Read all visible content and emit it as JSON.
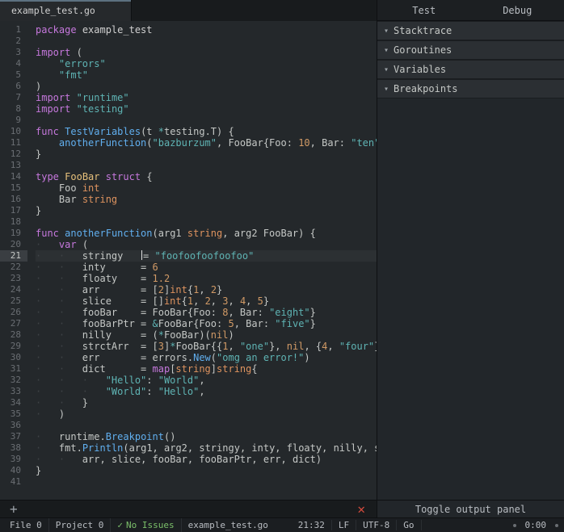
{
  "tab": {
    "filename": "example_test.go"
  },
  "sidebar": {
    "tabs": [
      "Test",
      "Debug"
    ],
    "sections": [
      "Stacktrace",
      "Goroutines",
      "Variables",
      "Breakpoints"
    ],
    "footer": "Toggle output panel"
  },
  "status": {
    "file_label": "File",
    "file_count": "0",
    "project_label": "Project",
    "project_count": "0",
    "issues": "No Issues",
    "filename": "example_test.go",
    "cursor": "21:32",
    "eol": "LF",
    "encoding": "UTF-8",
    "lang": "Go",
    "clock": "0:00"
  },
  "editor": {
    "current_line": 21,
    "cursor_col": 32
  },
  "code": {
    "lines": [
      {
        "n": 1,
        "tokens": [
          [
            "kw",
            "package"
          ],
          [
            "op",
            " "
          ],
          [
            "pkg",
            "example_test"
          ]
        ]
      },
      {
        "n": 2,
        "tokens": []
      },
      {
        "n": 3,
        "tokens": [
          [
            "kw",
            "import"
          ],
          [
            "op",
            " "
          ],
          [
            "punc",
            "("
          ]
        ]
      },
      {
        "n": 4,
        "tokens": [
          [
            "ind",
            "    "
          ],
          [
            "str",
            "\"errors\""
          ]
        ]
      },
      {
        "n": 5,
        "tokens": [
          [
            "ind",
            "    "
          ],
          [
            "str",
            "\"fmt\""
          ]
        ]
      },
      {
        "n": 6,
        "tokens": [
          [
            "punc",
            ")"
          ]
        ]
      },
      {
        "n": 7,
        "tokens": [
          [
            "kw",
            "import"
          ],
          [
            "op",
            " "
          ],
          [
            "str",
            "\"runtime\""
          ]
        ]
      },
      {
        "n": 8,
        "tokens": [
          [
            "kw",
            "import"
          ],
          [
            "op",
            " "
          ],
          [
            "str",
            "\"testing\""
          ]
        ]
      },
      {
        "n": 9,
        "tokens": []
      },
      {
        "n": 10,
        "tokens": [
          [
            "kw",
            "func"
          ],
          [
            "op",
            " "
          ],
          [
            "fn",
            "TestVariables"
          ],
          [
            "punc",
            "("
          ],
          [
            "op",
            "t "
          ],
          [
            "star",
            "*"
          ],
          [
            "op",
            "testing"
          ],
          [
            "punc",
            "."
          ],
          [
            "op",
            "T"
          ],
          [
            "punc",
            ") {"
          ]
        ]
      },
      {
        "n": 11,
        "tokens": [
          [
            "ind",
            "    "
          ],
          [
            "fn",
            "anotherFunction"
          ],
          [
            "punc",
            "("
          ],
          [
            "str",
            "\"bazburzum\""
          ],
          [
            "punc",
            ", "
          ],
          [
            "op",
            "FooBar"
          ],
          [
            "punc",
            "{"
          ],
          [
            "op",
            "Foo"
          ],
          [
            "punc",
            ": "
          ],
          [
            "num",
            "10"
          ],
          [
            "punc",
            ", "
          ],
          [
            "op",
            "Bar"
          ],
          [
            "punc",
            ": "
          ],
          [
            "str",
            "\"ten\""
          ],
          [
            "punc",
            "})"
          ]
        ]
      },
      {
        "n": 12,
        "tokens": [
          [
            "punc",
            "}"
          ]
        ]
      },
      {
        "n": 13,
        "tokens": []
      },
      {
        "n": 14,
        "tokens": [
          [
            "kw",
            "type"
          ],
          [
            "op",
            " "
          ],
          [
            "ident",
            "FooBar"
          ],
          [
            "op",
            " "
          ],
          [
            "kw",
            "struct"
          ],
          [
            "op",
            " "
          ],
          [
            "punc",
            "{"
          ]
        ]
      },
      {
        "n": 15,
        "tokens": [
          [
            "ind",
            "    "
          ],
          [
            "op",
            "Foo "
          ],
          [
            "typ",
            "int"
          ]
        ]
      },
      {
        "n": 16,
        "tokens": [
          [
            "ind",
            "    "
          ],
          [
            "op",
            "Bar "
          ],
          [
            "typ",
            "string"
          ]
        ]
      },
      {
        "n": 17,
        "tokens": [
          [
            "punc",
            "}"
          ]
        ]
      },
      {
        "n": 18,
        "tokens": []
      },
      {
        "n": 19,
        "tokens": [
          [
            "kw",
            "func"
          ],
          [
            "op",
            " "
          ],
          [
            "fn",
            "anotherFunction"
          ],
          [
            "punc",
            "("
          ],
          [
            "op",
            "arg1 "
          ],
          [
            "typ",
            "string"
          ],
          [
            "punc",
            ", "
          ],
          [
            "op",
            "arg2 FooBar"
          ],
          [
            "punc",
            ") {"
          ]
        ]
      },
      {
        "n": 20,
        "tokens": [
          [
            "ind",
            "·   "
          ],
          [
            "kw",
            "var"
          ],
          [
            "op",
            " "
          ],
          [
            "punc",
            "("
          ]
        ]
      },
      {
        "n": 21,
        "current": true,
        "tokens": [
          [
            "ind",
            "·   ·   "
          ],
          [
            "op",
            "stringy   "
          ],
          [
            "cursor",
            ""
          ],
          [
            "punc",
            "= "
          ],
          [
            "str",
            "\"foofoofoofoofoo\""
          ]
        ]
      },
      {
        "n": 22,
        "tokens": [
          [
            "ind",
            "·   ·   "
          ],
          [
            "op",
            "inty      "
          ],
          [
            "punc",
            "= "
          ],
          [
            "num",
            "6"
          ]
        ]
      },
      {
        "n": 23,
        "tokens": [
          [
            "ind",
            "·   ·   "
          ],
          [
            "op",
            "floaty    "
          ],
          [
            "punc",
            "= "
          ],
          [
            "num",
            "1.2"
          ]
        ]
      },
      {
        "n": 24,
        "tokens": [
          [
            "ind",
            "·   ·   "
          ],
          [
            "op",
            "arr       "
          ],
          [
            "punc",
            "= ["
          ],
          [
            "num",
            "2"
          ],
          [
            "punc",
            "]"
          ],
          [
            "typ",
            "int"
          ],
          [
            "punc",
            "{"
          ],
          [
            "num",
            "1"
          ],
          [
            "punc",
            ", "
          ],
          [
            "num",
            "2"
          ],
          [
            "punc",
            "}"
          ]
        ]
      },
      {
        "n": 25,
        "tokens": [
          [
            "ind",
            "·   ·   "
          ],
          [
            "op",
            "slice     "
          ],
          [
            "punc",
            "= []"
          ],
          [
            "typ",
            "int"
          ],
          [
            "punc",
            "{"
          ],
          [
            "num",
            "1"
          ],
          [
            "punc",
            ", "
          ],
          [
            "num",
            "2"
          ],
          [
            "punc",
            ", "
          ],
          [
            "num",
            "3"
          ],
          [
            "punc",
            ", "
          ],
          [
            "num",
            "4"
          ],
          [
            "punc",
            ", "
          ],
          [
            "num",
            "5"
          ],
          [
            "punc",
            "}"
          ]
        ]
      },
      {
        "n": 26,
        "tokens": [
          [
            "ind",
            "·   ·   "
          ],
          [
            "op",
            "fooBar    "
          ],
          [
            "punc",
            "= "
          ],
          [
            "op",
            "FooBar"
          ],
          [
            "punc",
            "{"
          ],
          [
            "op",
            "Foo"
          ],
          [
            "punc",
            ": "
          ],
          [
            "num",
            "8"
          ],
          [
            "punc",
            ", "
          ],
          [
            "op",
            "Bar"
          ],
          [
            "punc",
            ": "
          ],
          [
            "str",
            "\"eight\""
          ],
          [
            "punc",
            "}"
          ]
        ]
      },
      {
        "n": 27,
        "tokens": [
          [
            "ind",
            "·   ·   "
          ],
          [
            "op",
            "fooBarPtr "
          ],
          [
            "punc",
            "= "
          ],
          [
            "star",
            "&"
          ],
          [
            "op",
            "FooBar"
          ],
          [
            "punc",
            "{"
          ],
          [
            "op",
            "Foo"
          ],
          [
            "punc",
            ": "
          ],
          [
            "num",
            "5"
          ],
          [
            "punc",
            ", "
          ],
          [
            "op",
            "Bar"
          ],
          [
            "punc",
            ": "
          ],
          [
            "str",
            "\"five\""
          ],
          [
            "punc",
            "}"
          ]
        ]
      },
      {
        "n": 28,
        "tokens": [
          [
            "ind",
            "·   ·   "
          ],
          [
            "op",
            "nilly     "
          ],
          [
            "punc",
            "= ("
          ],
          [
            "star",
            "*"
          ],
          [
            "op",
            "FooBar"
          ],
          [
            "punc",
            ")("
          ],
          [
            "nil",
            "nil"
          ],
          [
            "punc",
            ")"
          ]
        ]
      },
      {
        "n": 29,
        "tokens": [
          [
            "ind",
            "·   ·   "
          ],
          [
            "op",
            "strctArr  "
          ],
          [
            "punc",
            "= ["
          ],
          [
            "num",
            "3"
          ],
          [
            "punc",
            "]"
          ],
          [
            "star",
            "*"
          ],
          [
            "op",
            "FooBar"
          ],
          [
            "punc",
            "{{"
          ],
          [
            "num",
            "1"
          ],
          [
            "punc",
            ", "
          ],
          [
            "str",
            "\"one\""
          ],
          [
            "punc",
            "}, "
          ],
          [
            "nil",
            "nil"
          ],
          [
            "punc",
            ", {"
          ],
          [
            "num",
            "4"
          ],
          [
            "punc",
            ", "
          ],
          [
            "str",
            "\"four\""
          ],
          [
            "punc",
            "}}"
          ]
        ]
      },
      {
        "n": 30,
        "tokens": [
          [
            "ind",
            "·   ·   "
          ],
          [
            "op",
            "err       "
          ],
          [
            "punc",
            "= "
          ],
          [
            "op",
            "errors"
          ],
          [
            "punc",
            "."
          ],
          [
            "fn",
            "New"
          ],
          [
            "punc",
            "("
          ],
          [
            "str",
            "\"omg an error!\""
          ],
          [
            "punc",
            ")"
          ]
        ]
      },
      {
        "n": 31,
        "tokens": [
          [
            "ind",
            "·   ·   "
          ],
          [
            "op",
            "dict      "
          ],
          [
            "punc",
            "= "
          ],
          [
            "kw",
            "map"
          ],
          [
            "punc",
            "["
          ],
          [
            "typ",
            "string"
          ],
          [
            "punc",
            "]"
          ],
          [
            "typ",
            "string"
          ],
          [
            "punc",
            "{"
          ]
        ]
      },
      {
        "n": 32,
        "tokens": [
          [
            "ind",
            "·   ·   ·   "
          ],
          [
            "str",
            "\"Hello\""
          ],
          [
            "punc",
            ": "
          ],
          [
            "str",
            "\"World\""
          ],
          [
            "punc",
            ","
          ]
        ]
      },
      {
        "n": 33,
        "tokens": [
          [
            "ind",
            "·   ·   ·   "
          ],
          [
            "str",
            "\"World\""
          ],
          [
            "punc",
            ": "
          ],
          [
            "str",
            "\"Hello\""
          ],
          [
            "punc",
            ","
          ]
        ]
      },
      {
        "n": 34,
        "tokens": [
          [
            "ind",
            "·   ·   "
          ],
          [
            "punc",
            "}"
          ]
        ]
      },
      {
        "n": 35,
        "tokens": [
          [
            "ind",
            "·   "
          ],
          [
            "punc",
            ")"
          ]
        ]
      },
      {
        "n": 36,
        "tokens": []
      },
      {
        "n": 37,
        "tokens": [
          [
            "ind",
            "·   "
          ],
          [
            "op",
            "runtime"
          ],
          [
            "punc",
            "."
          ],
          [
            "fn",
            "Breakpoint"
          ],
          [
            "punc",
            "()"
          ]
        ]
      },
      {
        "n": 38,
        "tokens": [
          [
            "ind",
            "·   "
          ],
          [
            "op",
            "fmt"
          ],
          [
            "punc",
            "."
          ],
          [
            "fn",
            "Println"
          ],
          [
            "punc",
            "("
          ],
          [
            "op",
            "arg1"
          ],
          [
            "punc",
            ", "
          ],
          [
            "op",
            "arg2"
          ],
          [
            "punc",
            ", "
          ],
          [
            "op",
            "stringy"
          ],
          [
            "punc",
            ", "
          ],
          [
            "op",
            "inty"
          ],
          [
            "punc",
            ", "
          ],
          [
            "op",
            "floaty"
          ],
          [
            "punc",
            ", "
          ],
          [
            "op",
            "nilly"
          ],
          [
            "punc",
            ", "
          ],
          [
            "op",
            "strctArr"
          ],
          [
            "punc",
            ","
          ]
        ]
      },
      {
        "n": 39,
        "tokens": [
          [
            "ind",
            "·   ·   "
          ],
          [
            "op",
            "arr"
          ],
          [
            "punc",
            ", "
          ],
          [
            "op",
            "slice"
          ],
          [
            "punc",
            ", "
          ],
          [
            "op",
            "fooBar"
          ],
          [
            "punc",
            ", "
          ],
          [
            "op",
            "fooBarPtr"
          ],
          [
            "punc",
            ", "
          ],
          [
            "op",
            "err"
          ],
          [
            "punc",
            ", "
          ],
          [
            "op",
            "dict"
          ],
          [
            "punc",
            ")"
          ]
        ]
      },
      {
        "n": 40,
        "tokens": [
          [
            "punc",
            "}"
          ]
        ]
      },
      {
        "n": 41,
        "tokens": []
      }
    ]
  }
}
